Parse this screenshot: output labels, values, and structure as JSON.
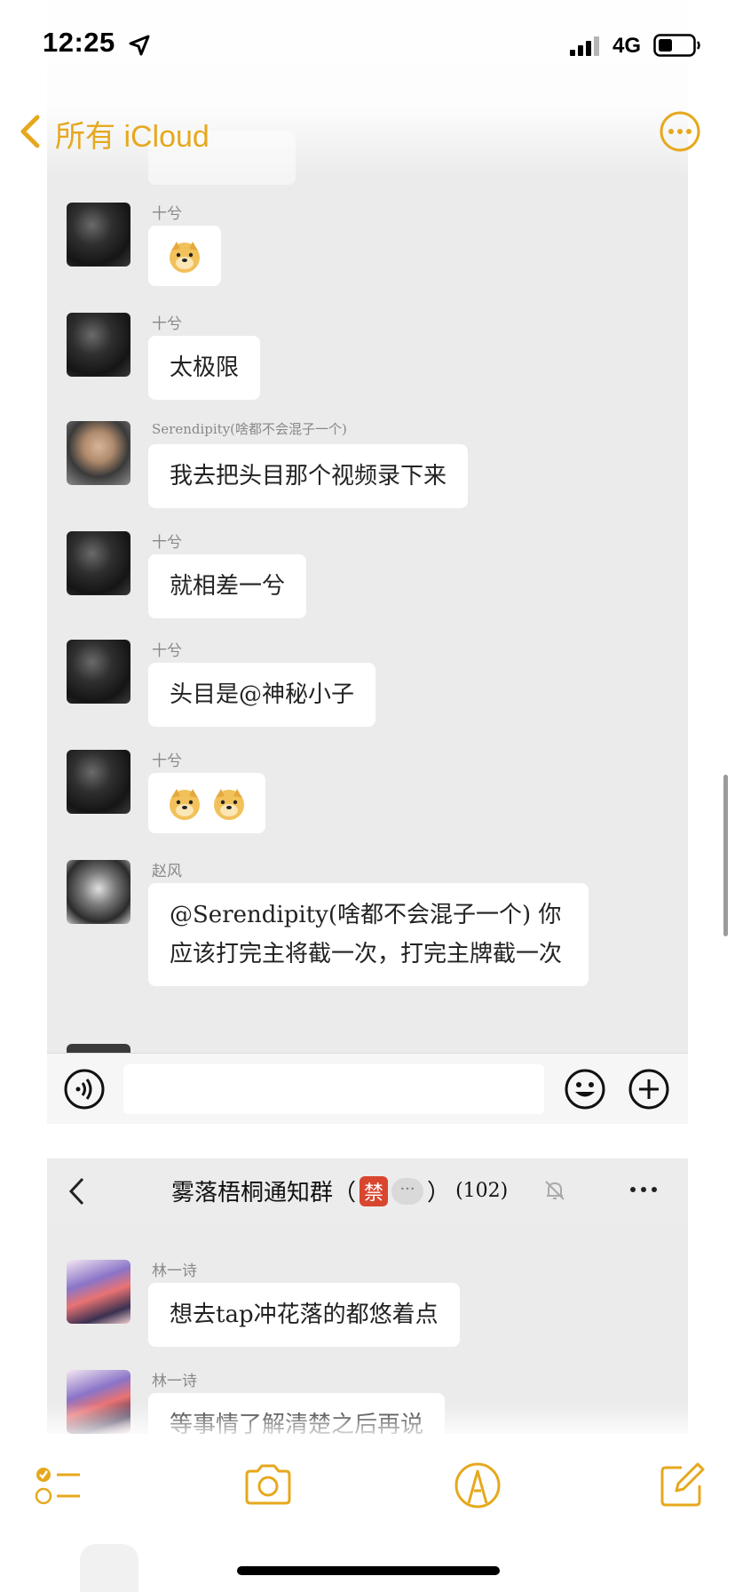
{
  "status_bar": {
    "time": "12:25",
    "network": "4G",
    "icons": [
      "location-arrow-icon",
      "signal-bars-icon",
      "battery-icon"
    ]
  },
  "nav": {
    "back_label": "所有 iCloud",
    "accent_color": "#e6a81d",
    "icons": [
      "chevron-left-icon",
      "more-circle-icon"
    ]
  },
  "chat_screenshot_1": {
    "messages": [
      {
        "sender": "十兮",
        "text": "",
        "emoji": [
          "doge-emoji"
        ]
      },
      {
        "sender": "十兮",
        "text": "太极限"
      },
      {
        "sender": "Serendipity(啥都不会混子一个)",
        "text": "我去把头目那个视频录下来"
      },
      {
        "sender": "十兮",
        "text": "就相差一兮"
      },
      {
        "sender": "十兮",
        "text": "头目是@神秘小子"
      },
      {
        "sender": "十兮",
        "text": "",
        "emoji": [
          "doge-emoji",
          "doge-emoji"
        ]
      },
      {
        "sender": "赵风",
        "text": "@Serendipity(啥都不会混子一个) 你应该打完主将截一次，打完主牌截一次"
      }
    ],
    "input": {
      "value": "",
      "placeholder": ""
    },
    "icons": [
      "voice-icon",
      "emoji-icon",
      "plus-icon"
    ]
  },
  "chat_screenshot_2": {
    "group_title": "雾落梧桐通知群",
    "title_open": "（",
    "title_close": "）",
    "tag": "禁",
    "tag_bubble": "···",
    "member_count": "(102)",
    "messages": [
      {
        "sender": "林一诗",
        "text": "想去tap冲花落的都悠着点"
      },
      {
        "sender": "林一诗",
        "text": "等事情了解清楚之后再说"
      }
    ],
    "icons": [
      "chevron-left-icon",
      "bell-off-icon",
      "more-dots-icon"
    ]
  },
  "toolbar": {
    "icons": [
      "checklist-icon",
      "camera-icon",
      "markup-pen-icon",
      "compose-icon"
    ]
  }
}
